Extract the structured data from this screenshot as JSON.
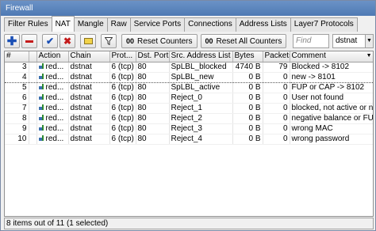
{
  "window": {
    "title": "Firewall"
  },
  "tabs": [
    "Filter Rules",
    "NAT",
    "Mangle",
    "Raw",
    "Service Ports",
    "Connections",
    "Address Lists",
    "Layer7 Protocols"
  ],
  "active_tab": "NAT",
  "toolbar": {
    "add_icon": "plus-icon",
    "remove_icon": "minus-icon",
    "enable_icon": "check-icon",
    "disable_icon": "x-icon",
    "comment_icon": "note-icon",
    "filter_icon": "funnel-icon",
    "reset_counters_label": "Reset Counters",
    "reset_all_counters_label": "Reset All Counters",
    "counter_prefix": "00",
    "find_placeholder": "Find",
    "chain_filter_value": "dstnat"
  },
  "columns": [
    "#",
    "",
    "Action",
    "Chain",
    "Prot...",
    "Dst. Port",
    "Src. Address List",
    "Bytes",
    "Packets",
    "Comment"
  ],
  "rows": [
    {
      "id": "3",
      "action": "red...",
      "chain": "dstnat",
      "protocol": "6 (tcp)",
      "dst_port": "80",
      "src_list": "SpLBL_blocked",
      "bytes": "4740 B",
      "packets": "79",
      "comment": "Blocked -> 8102"
    },
    {
      "id": "4",
      "action": "red...",
      "chain": "dstnat",
      "protocol": "6 (tcp)",
      "dst_port": "80",
      "src_list": "SpLBL_new",
      "bytes": "0 B",
      "packets": "0",
      "comment": "new -> 8101"
    },
    {
      "id": "5",
      "action": "red...",
      "chain": "dstnat",
      "protocol": "6 (tcp)",
      "dst_port": "80",
      "src_list": "SpLBL_active",
      "bytes": "0 B",
      "packets": "0",
      "comment": "FUP or CAP -> 8102"
    },
    {
      "id": "6",
      "action": "red...",
      "chain": "dstnat",
      "protocol": "6 (tcp)",
      "dst_port": "80",
      "src_list": "Reject_0",
      "bytes": "0 B",
      "packets": "0",
      "comment": "User not found"
    },
    {
      "id": "7",
      "action": "red...",
      "chain": "dstnat",
      "protocol": "6 (tcp)",
      "dst_port": "80",
      "src_list": "Reject_1",
      "bytes": "0 B",
      "packets": "0",
      "comment": "blocked, not active or n..."
    },
    {
      "id": "8",
      "action": "red...",
      "chain": "dstnat",
      "protocol": "6 (tcp)",
      "dst_port": "80",
      "src_list": "Reject_2",
      "bytes": "0 B",
      "packets": "0",
      "comment": "negative balance or FUP..."
    },
    {
      "id": "9",
      "action": "red...",
      "chain": "dstnat",
      "protocol": "6 (tcp)",
      "dst_port": "80",
      "src_list": "Reject_3",
      "bytes": "0 B",
      "packets": "0",
      "comment": "wrong MAC"
    },
    {
      "id": "10",
      "action": "red...",
      "chain": "dstnat",
      "protocol": "6 (tcp)",
      "dst_port": "80",
      "src_list": "Reject_4",
      "bytes": "0 B",
      "packets": "0",
      "comment": "wrong password"
    }
  ],
  "selected_row": "4",
  "status": {
    "text": "8 items out of 11 (1 selected)"
  },
  "colors": {
    "title_bar": "#5b86bf",
    "add": "#1a4fb5",
    "remove": "#c41a1a",
    "enable": "#1a4fb5",
    "disable": "#c41a1a"
  }
}
